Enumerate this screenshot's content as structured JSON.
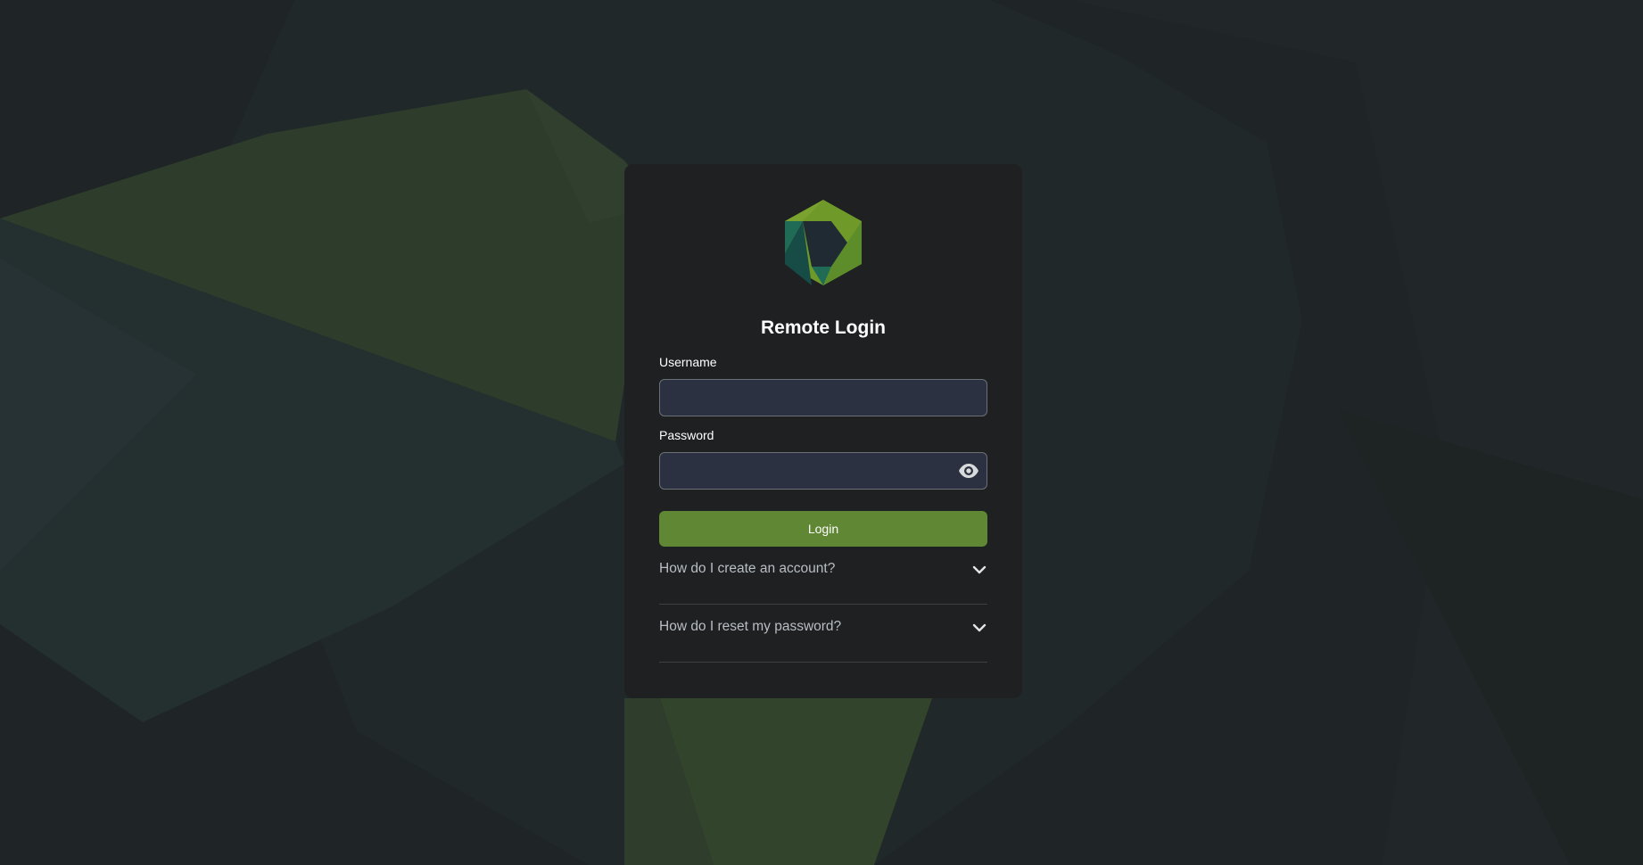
{
  "colors": {
    "background": "#1f2426",
    "card": "#1e2022",
    "input_bg": "#2b3140",
    "accent_green": "#5f8734",
    "text": "#ffffff",
    "muted_text": "#b9bec4"
  },
  "logo": {
    "icon": "hexagon-logo-icon"
  },
  "title": "Remote Login",
  "username": {
    "label": "Username",
    "value": "",
    "placeholder": ""
  },
  "password": {
    "label": "Password",
    "value": "",
    "placeholder": "",
    "toggle_icon": "eye-icon"
  },
  "login_button": {
    "label": "Login"
  },
  "faq": [
    {
      "question": "How do I create an account?",
      "icon": "chevron-down-icon"
    },
    {
      "question": "How do I reset my password?",
      "icon": "chevron-down-icon"
    }
  ]
}
